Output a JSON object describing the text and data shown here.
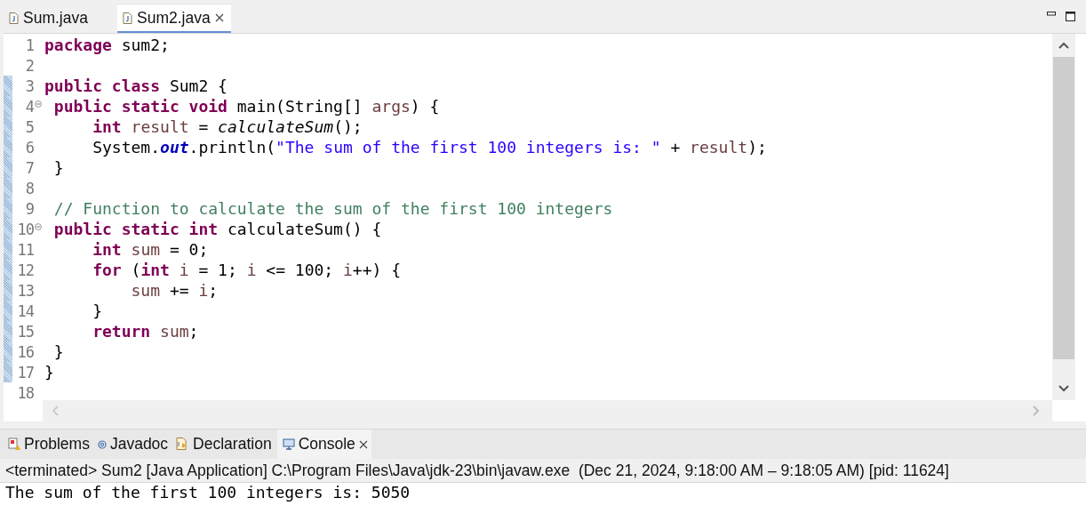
{
  "editor_tabs": [
    {
      "label": "Sum.java",
      "selected": false
    },
    {
      "label": "Sum2.java",
      "selected": true
    }
  ],
  "code_lines": [
    {
      "number": "1",
      "changed": false,
      "collapsible": false,
      "tokens": [
        {
          "kind": "kw",
          "text": "package"
        },
        {
          "kind": "id",
          "text": " sum2;"
        }
      ]
    },
    {
      "number": "2",
      "changed": false,
      "collapsible": false
    },
    {
      "number": "3",
      "changed": true,
      "collapsible": false,
      "tokens": [
        {
          "kind": "kw",
          "text": "public class"
        },
        {
          "kind": "id",
          "text": " Sum2 {"
        }
      ]
    },
    {
      "number": "4",
      "changed": true,
      "collapsible": true,
      "tokens": [
        {
          "kind": "kw",
          "text": " public static void"
        },
        {
          "kind": "id",
          "text": " main(String[] "
        },
        {
          "kind": "var",
          "text": "args"
        },
        {
          "kind": "id",
          "text": ") {"
        }
      ]
    },
    {
      "number": "5",
      "changed": true,
      "collapsible": false,
      "tokens": [
        {
          "kind": "kw",
          "text": "     int"
        },
        {
          "kind": "var",
          "text": " result"
        },
        {
          "kind": "id",
          "text": " = "
        },
        {
          "kind": "call",
          "text": "calculateSum"
        },
        {
          "kind": "id",
          "text": "();"
        }
      ]
    },
    {
      "number": "6",
      "changed": true,
      "collapsible": false,
      "tokens": [
        {
          "kind": "id",
          "text": "     System."
        },
        {
          "kind": "field",
          "text": "out"
        },
        {
          "kind": "id",
          "text": ".println("
        },
        {
          "kind": "str",
          "text": "\"The sum of the first 100 integers is: \""
        },
        {
          "kind": "id",
          "text": " + "
        },
        {
          "kind": "var",
          "text": "result"
        },
        {
          "kind": "id",
          "text": ");"
        }
      ]
    },
    {
      "number": "7",
      "changed": true,
      "collapsible": false,
      "tokens": [
        {
          "kind": "id",
          "text": " }"
        }
      ]
    },
    {
      "number": "8",
      "changed": true,
      "collapsible": false
    },
    {
      "number": "9",
      "changed": true,
      "collapsible": false,
      "tokens": [
        {
          "kind": "cmt",
          "text": " // Function to calculate the sum of the first 100 integers"
        }
      ]
    },
    {
      "number": "10",
      "changed": true,
      "collapsible": true,
      "tokens": [
        {
          "kind": "kw",
          "text": " public static int"
        },
        {
          "kind": "id",
          "text": " calculateSum() {"
        }
      ]
    },
    {
      "number": "11",
      "changed": true,
      "collapsible": false,
      "tokens": [
        {
          "kind": "kw",
          "text": "     int"
        },
        {
          "kind": "var",
          "text": " sum"
        },
        {
          "kind": "id",
          "text": " = 0;"
        }
      ]
    },
    {
      "number": "12",
      "changed": true,
      "collapsible": false,
      "tokens": [
        {
          "kind": "kw",
          "text": "     for"
        },
        {
          "kind": "id",
          "text": " ("
        },
        {
          "kind": "kw",
          "text": "int"
        },
        {
          "kind": "var",
          "text": " i"
        },
        {
          "kind": "id",
          "text": " = 1; "
        },
        {
          "kind": "var",
          "text": "i"
        },
        {
          "kind": "id",
          "text": " <= 100; "
        },
        {
          "kind": "var",
          "text": "i"
        },
        {
          "kind": "id",
          "text": "++) {"
        }
      ]
    },
    {
      "number": "13",
      "changed": true,
      "collapsible": false,
      "tokens": [
        {
          "kind": "var",
          "text": "         sum"
        },
        {
          "kind": "id",
          "text": " += "
        },
        {
          "kind": "var",
          "text": "i"
        },
        {
          "kind": "id",
          "text": ";"
        }
      ]
    },
    {
      "number": "14",
      "changed": true,
      "collapsible": false,
      "tokens": [
        {
          "kind": "id",
          "text": "     }"
        }
      ]
    },
    {
      "number": "15",
      "changed": true,
      "collapsible": false,
      "tokens": [
        {
          "kind": "kw",
          "text": "     return"
        },
        {
          "kind": "var",
          "text": " sum"
        },
        {
          "kind": "id",
          "text": ";"
        }
      ]
    },
    {
      "number": "16",
      "changed": true,
      "collapsible": false,
      "tokens": [
        {
          "kind": "id",
          "text": " }"
        }
      ]
    },
    {
      "number": "17",
      "changed": true,
      "collapsible": false,
      "tokens": [
        {
          "kind": "id",
          "text": "}"
        }
      ]
    },
    {
      "number": "18",
      "changed": false,
      "collapsible": false
    }
  ],
  "view_tabs": [
    {
      "label": "Problems",
      "kind": "problems",
      "selected": false
    },
    {
      "label": "Javadoc",
      "kind": "javadoc",
      "selected": false
    },
    {
      "label": "Declaration",
      "kind": "declaration",
      "selected": false
    },
    {
      "label": "Console",
      "kind": "console",
      "selected": true
    }
  ],
  "console": {
    "status": "<terminated> Sum2 [Java Application] C:\\Program Files\\Java\\jdk-23\\bin\\javaw.exe  (Dec 21, 2024, 9:18:00 AM – 9:18:05 AM) [pid: 11624]",
    "output": "The sum of the first 100 integers is: 5050"
  }
}
